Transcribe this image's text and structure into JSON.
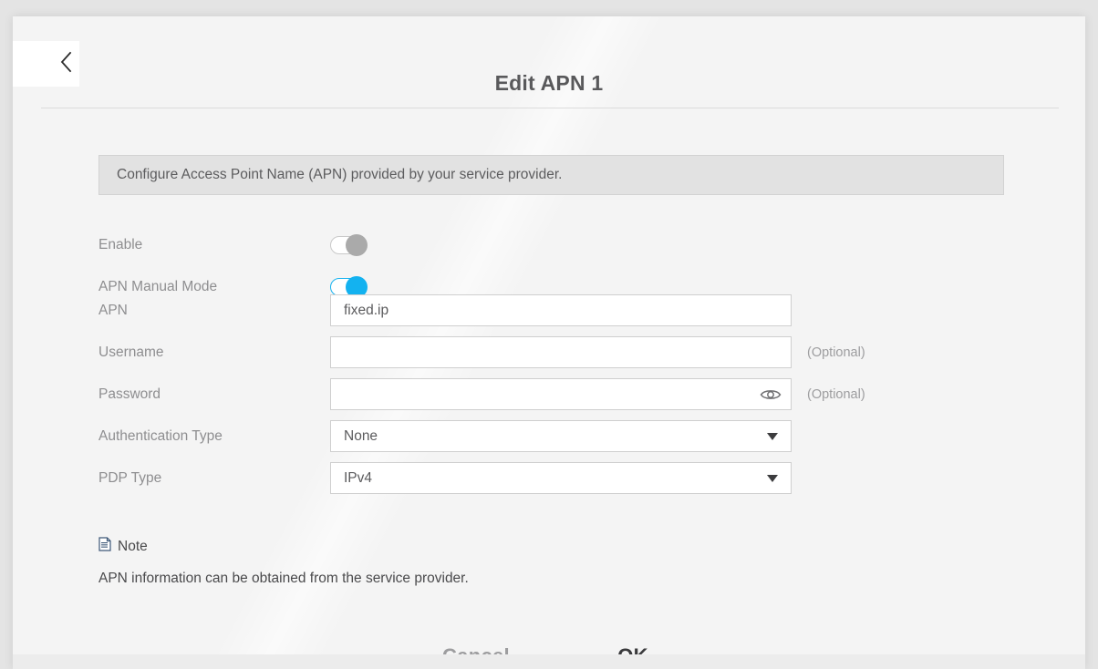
{
  "header": {
    "back_icon": "chevron-left-icon",
    "title": "Edit APN 1"
  },
  "banner": {
    "text": "Configure Access Point Name (APN) provided by your service provider."
  },
  "form": {
    "rows": [
      {
        "label": "Enable",
        "type": "toggle",
        "value": "off",
        "state_color": "#aaaaaa"
      },
      {
        "label": "APN Manual Mode",
        "type": "toggle",
        "value": "on",
        "state_color": "#13b2f0"
      },
      {
        "label": "APN",
        "type": "text",
        "value": "fixed.ip",
        "placeholder": ""
      },
      {
        "label": "Username",
        "type": "text",
        "value": "",
        "placeholder": "",
        "hint": "(Optional)"
      },
      {
        "label": "Password",
        "type": "password",
        "value": "",
        "placeholder": "",
        "hint": "(Optional)",
        "icon": "eye-icon"
      },
      {
        "label": "Authentication Type",
        "type": "select",
        "value": "None"
      },
      {
        "label": "PDP Type",
        "type": "select",
        "value": "IPv4"
      }
    ]
  },
  "note": {
    "icon": "document-icon",
    "title": "Note",
    "body": "APN information can be obtained from the service provider."
  },
  "footer": {
    "cancel_label": "Cancel",
    "ok_label": "OK",
    "ok_highlight_color": "#ffc800"
  }
}
